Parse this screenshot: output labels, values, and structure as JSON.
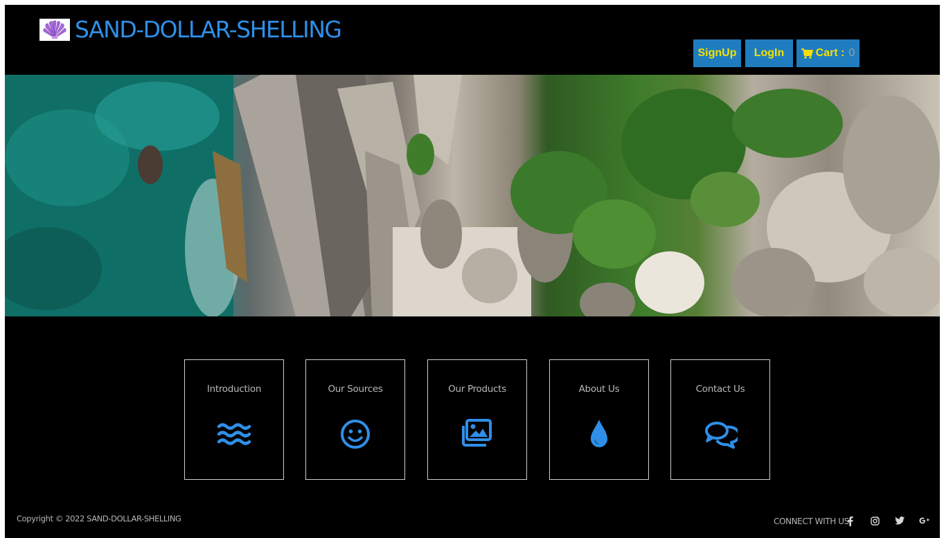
{
  "header": {
    "brand": "SAND-DOLLAR-SHELLING",
    "logo_icon": "shell-icon",
    "signup_label": "SignUp",
    "login_label": "LogIn",
    "cart_label": "Cart :",
    "cart_count": "0",
    "cart_icon": "cart-icon"
  },
  "hero": {
    "image": "aerial-beach-rocks-photo"
  },
  "cards": [
    {
      "label": "Introduction",
      "icon": "water-waves-icon"
    },
    {
      "label": "Our Sources",
      "icon": "smile-icon"
    },
    {
      "label": "Our Products",
      "icon": "images-icon"
    },
    {
      "label": "About Us",
      "icon": "droplet-icon"
    },
    {
      "label": "Contact Us",
      "icon": "comments-icon"
    }
  ],
  "footer": {
    "copyright": "Copyright © 2022 SAND-DOLLAR-SHELLING",
    "connect_label": "CONNECT WITH US",
    "social_icons": [
      "facebook-icon",
      "instagram-icon",
      "twitter-icon",
      "google-plus-icon"
    ]
  },
  "colors": {
    "brand_blue": "#2f8fe8",
    "button_bg": "#1f7dbf",
    "button_text": "#f5e000",
    "page_bg": "#000000"
  }
}
